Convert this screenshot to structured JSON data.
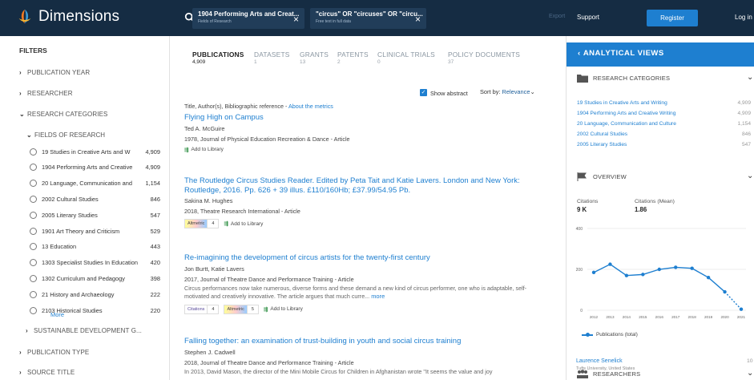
{
  "app": {
    "name": "Dimensions"
  },
  "search": {
    "chips": [
      {
        "title": "1904 Performing Arts and Creat...",
        "subtitle": "Fields of Research"
      },
      {
        "title": "\"circus\" OR \"circuses\" OR \"circu...",
        "subtitle": "Free text in full data"
      }
    ]
  },
  "topnav": {
    "export": "Export",
    "support": "Support",
    "register": "Register",
    "login": "Log in"
  },
  "filters": {
    "title": "FILTERS",
    "publication_year": "PUBLICATION YEAR",
    "researcher": "RESEARCHER",
    "research_categories": "RESEARCH CATEGORIES",
    "fields_of_research": "FIELDS OF RESEARCH",
    "fields": [
      {
        "label": "19 Studies in Creative Arts and W",
        "count": "4,909"
      },
      {
        "label": "1904 Performing Arts and Creative",
        "count": "4,909"
      },
      {
        "label": "20 Language, Communication and",
        "count": "1,154"
      },
      {
        "label": "2002 Cultural Studies",
        "count": "846"
      },
      {
        "label": "2005 Literary Studies",
        "count": "547"
      },
      {
        "label": "1901 Art Theory and Criticism",
        "count": "529"
      },
      {
        "label": "13 Education",
        "count": "443"
      },
      {
        "label": "1303 Specialist Studies In Education",
        "count": "420"
      },
      {
        "label": "1302 Curriculum and Pedagogy",
        "count": "398"
      },
      {
        "label": "21 History and Archaeology",
        "count": "222"
      },
      {
        "label": "2103 Historical Studies",
        "count": "220"
      }
    ],
    "more": "More",
    "sustainable": "SUSTAINABLE DEVELOPMENT G...",
    "publication_type": "PUBLICATION TYPE",
    "source_title": "SOURCE TITLE"
  },
  "tabs": [
    {
      "name": "PUBLICATIONS",
      "count": "4,909"
    },
    {
      "name": "DATASETS",
      "count": "1"
    },
    {
      "name": "GRANTS",
      "count": "13"
    },
    {
      "name": "PATENTS",
      "count": "2"
    },
    {
      "name": "CLINICAL TRIALS",
      "count": "0"
    },
    {
      "name": "POLICY DOCUMENTS",
      "count": "37"
    }
  ],
  "controls": {
    "show_abstract": "Show abstract",
    "sort_by": "Sort by:",
    "sort_value": "Relevance"
  },
  "list_header": {
    "text": "Title, Author(s), Bibliographic reference - ",
    "link": "About the metrics"
  },
  "results": [
    {
      "title": "Flying High on Campus",
      "authors": "Ted A. McGuire",
      "meta": "1978, Journal of Physical Education Recreation & Dance - Article",
      "abstract": "",
      "add": "Add to Library"
    },
    {
      "title": "The Routledge Circus Studies Reader. Edited by Peta Tait and Katie Lavers. London and New York: Routledge, 2016. Pp. 626 + 39 illus. £110/160Hb; £37.99/54.95 Pb.",
      "authors": "Sakina M. Hughes",
      "meta": "2018, Theatre Research International - Article",
      "altmetric": "4",
      "add": "Add to Library"
    },
    {
      "title": "Re-imagining the development of circus artists for the twenty-first century",
      "authors": "Jon Burtt, Katie Lavers",
      "meta": "2017, Journal of Theatre Dance and Performance Training - Article",
      "abstract": "Circus performances now take numerous, diverse forms and these demand a new kind of circus performer, one who is adaptable, self-motivated and creatively innovative. The article argues that much curre...",
      "abstract_more": "more",
      "citations": "4",
      "altmetric": "5",
      "add": "Add to Library"
    },
    {
      "title": "Falling together: an examination of trust-building in youth and social circus training",
      "authors": "Stephen J. Cadwell",
      "meta": "2018, Journal of Theatre Dance and Performance Training - Article",
      "abstract": "In 2013, David Mason, the director of the Mini Mobile Circus for Children in Afghanistan wrote \"It seems the value and joy"
    }
  ],
  "badges": {
    "altmetric": "Altmetric",
    "citations": "Citations"
  },
  "analytical": {
    "header": "ANALYTICAL VIEWS",
    "research_categories": {
      "title": "RESEARCH CATEGORIES",
      "items": [
        {
          "label": "19 Studies in Creative Arts and Writing",
          "value": "4,909"
        },
        {
          "label": "1904 Performing Arts and Creative Writing",
          "value": "4,909"
        },
        {
          "label": "20 Language, Communication and Culture",
          "value": "1,154"
        },
        {
          "label": "2002 Cultural Studies",
          "value": "846"
        },
        {
          "label": "2005 Literary Studies",
          "value": "547"
        }
      ]
    },
    "overview": {
      "title": "OVERVIEW",
      "citations_label": "Citations",
      "citations_value": "9 K",
      "mean_label": "Citations (Mean)",
      "mean_value": "1.86"
    },
    "researchers": {
      "title": "RESEARCHERS",
      "top_name": "Laurence Senelick",
      "top_affiliation": "Tufts University, United States",
      "top_count": "10"
    }
  },
  "chart_data": {
    "type": "line",
    "x": [
      "2012",
      "2013",
      "2014",
      "2015",
      "2016",
      "2017",
      "2018",
      "2019",
      "2020",
      "2021"
    ],
    "series": [
      {
        "name": "Publications (total)",
        "values": [
          185,
          225,
          170,
          175,
          200,
          210,
          205,
          160,
          90,
          5
        ]
      }
    ],
    "ylim": [
      0,
      400
    ],
    "yticks": [
      0,
      200,
      400
    ],
    "legend": "Publications (total)",
    "last_segment_dashed": true,
    "color": "#1e7fd0"
  }
}
